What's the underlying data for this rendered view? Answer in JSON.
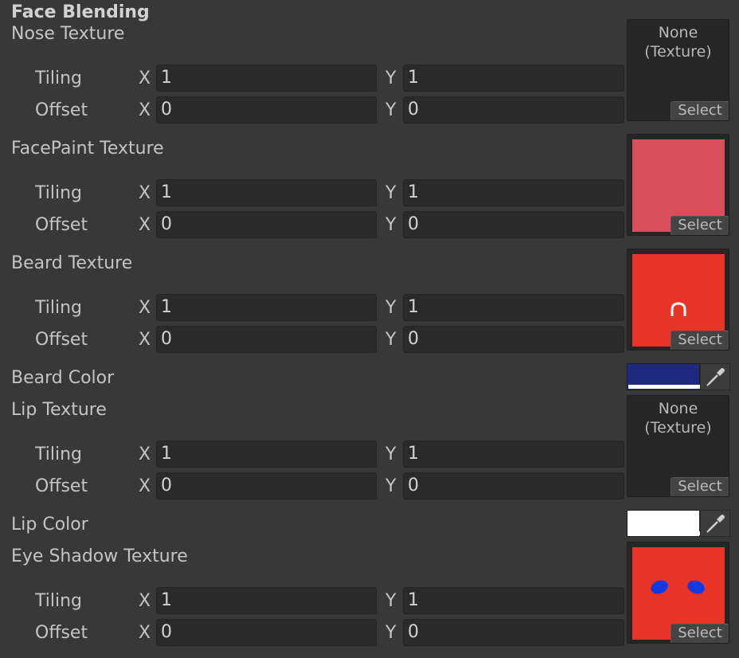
{
  "header": {
    "title": "Face Blending"
  },
  "labels": {
    "tiling": "Tiling",
    "offset": "Offset",
    "axis_x": "X",
    "axis_y": "Y",
    "select": "Select",
    "none": "None",
    "none_type": "(Texture)"
  },
  "textures": [
    {
      "title": "Nose Texture",
      "tiling_x": "1",
      "tiling_y": "1",
      "offset_x": "0",
      "offset_y": "0",
      "preview": "none"
    },
    {
      "title": "FacePaint Texture",
      "tiling_x": "1",
      "tiling_y": "1",
      "offset_x": "0",
      "offset_y": "0",
      "preview": "#d94f5c"
    },
    {
      "title": "Beard Texture",
      "tiling_x": "1",
      "tiling_y": "1",
      "offset_x": "0",
      "offset_y": "0",
      "preview": "#e83426"
    },
    {
      "title": "Lip Texture",
      "tiling_x": "1",
      "tiling_y": "1",
      "offset_x": "0",
      "offset_y": "0",
      "preview": "none"
    },
    {
      "title": "Eye Shadow Texture",
      "tiling_x": "1",
      "tiling_y": "1",
      "offset_x": "0",
      "offset_y": "0",
      "preview": "#e83426"
    }
  ],
  "colors": {
    "beard": {
      "label": "Beard Color",
      "value": "#1f2a7e"
    },
    "lip": {
      "label": "Lip Color",
      "value": "#ffffff"
    }
  },
  "icons": {
    "picker": "eyedropper-icon"
  }
}
